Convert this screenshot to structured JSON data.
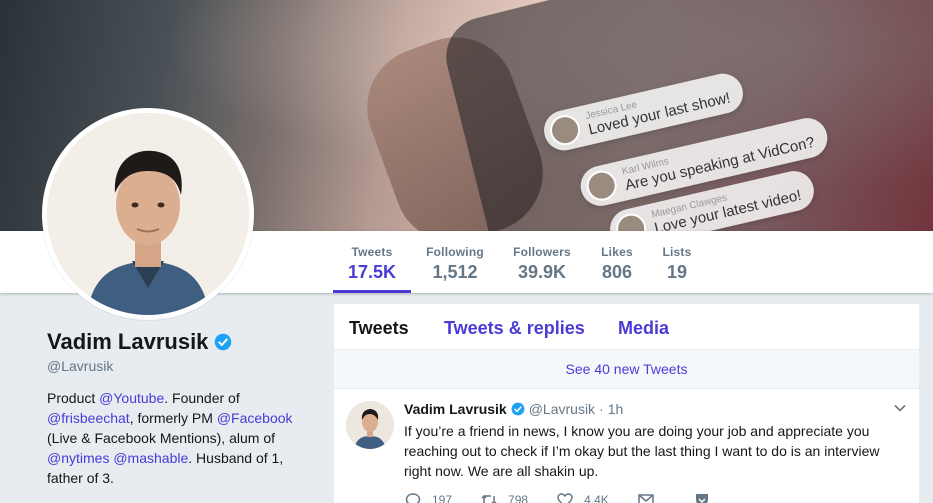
{
  "banner": {
    "bubbles": [
      {
        "name": "Jessica Lee",
        "message": "Loved your last show!"
      },
      {
        "name": "Karl Wilms",
        "message": "Are you speaking at VidCon?"
      },
      {
        "name": "Maegan Clawges",
        "message": "Love your latest video!"
      }
    ]
  },
  "stats": [
    {
      "label": "Tweets",
      "value": "17.5K"
    },
    {
      "label": "Following",
      "value": "1,512"
    },
    {
      "label": "Followers",
      "value": "39.9K"
    },
    {
      "label": "Likes",
      "value": "806"
    },
    {
      "label": "Lists",
      "value": "19"
    }
  ],
  "profile": {
    "name": "Vadim Lavrusik",
    "handle": "@Lavrusik",
    "bio": {
      "p1": "Product ",
      "l1": "@Youtube",
      "p2": ". Founder of ",
      "l2": "@frisbeechat",
      "p3": ", formerly PM ",
      "l3": "@Facebook",
      "p4": " (Live & Facebook Mentions), alum of ",
      "l4": "@nytimes",
      "p5": " ",
      "l5": "@mashable",
      "p6": ". Husband of 1, father of 3."
    }
  },
  "timeline": {
    "tabs": [
      "Tweets",
      "Tweets & replies",
      "Media"
    ],
    "new_tweets": "See 40 new Tweets",
    "tweet": {
      "name": "Vadim Lavrusik",
      "handle": "@Lavrusik",
      "dot": "·",
      "time": "1h",
      "text": "If you’re a friend in news, I know you are doing your job and appreciate you reaching out to check if I’m okay but the last thing I want to do is an interview right now. We are all shakin up.",
      "replies": "197",
      "retweets": "798",
      "likes": "4.4K"
    }
  },
  "colors": {
    "accent": "#4b3bd6",
    "verified": "#1da1f2",
    "muted": "#657786"
  }
}
